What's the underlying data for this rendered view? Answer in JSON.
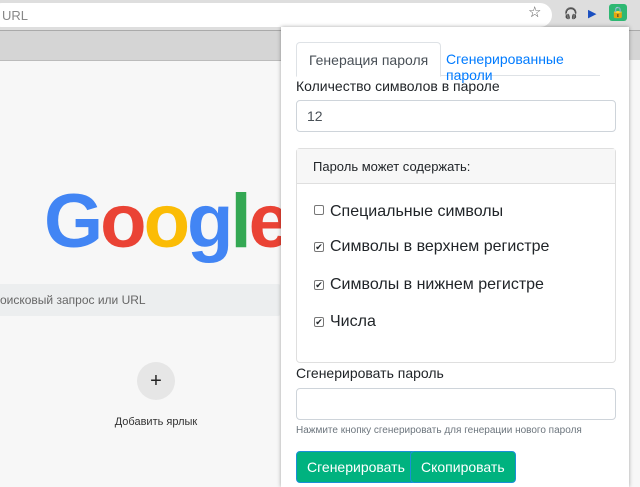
{
  "browser": {
    "url_placeholder": "URL",
    "star": "☆",
    "ext1": "🎧",
    "ext2": "▶",
    "ext3": "🔒"
  },
  "newtab": {
    "logo": [
      "G",
      "o",
      "o",
      "g",
      "l",
      "e"
    ],
    "logo_colors": [
      "#4285f4",
      "#ea4335",
      "#fbbc05",
      "#4285f4",
      "#34a853",
      "#ea4335"
    ],
    "search_placeholder": "оисковый запрос или URL",
    "add_shortcut_icon": "+",
    "add_shortcut_label": "Добавить ярлык"
  },
  "popup": {
    "tabs": [
      {
        "label": "Генерация пароля"
      },
      {
        "label": "Сгенерированные пароли"
      }
    ],
    "length_label": "Количество символов в пароле",
    "length_value": "12",
    "card_title": "Пароль может содержать:",
    "options": [
      {
        "label": "Специальные символы",
        "checked": false
      },
      {
        "label": "Символы в верхнем регистре",
        "checked": true
      },
      {
        "label": "Символы в нижнем регистре",
        "checked": true
      },
      {
        "label": "Числа",
        "checked": true
      }
    ],
    "generate_label": "Сгенерировать пароль",
    "generated_value": "",
    "help": "Нажмите кнопку сгенерировать для генерации нового пароля",
    "generate_button": "Сгенерировать",
    "copy_button": "Скопировать"
  }
}
